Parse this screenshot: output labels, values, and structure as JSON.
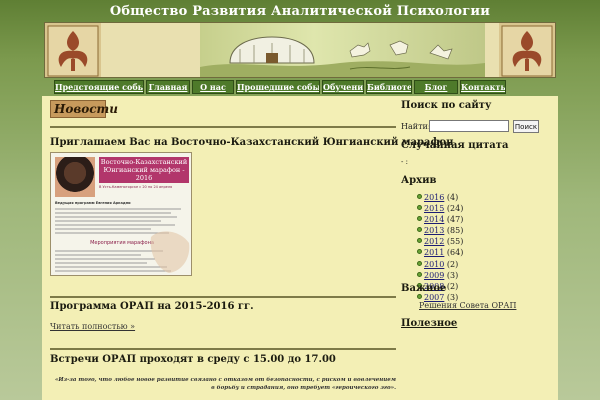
{
  "site": {
    "title": "Общество Развития Аналитической Психологии"
  },
  "nav": {
    "items": [
      {
        "label": "Предстоящие события"
      },
      {
        "label": "Главная"
      },
      {
        "label": "О нас"
      },
      {
        "label": "Прошедшие события"
      },
      {
        "label": "Обучение"
      },
      {
        "label": "Библиотека"
      },
      {
        "label": "Блог"
      },
      {
        "label": "Контакты"
      }
    ]
  },
  "main": {
    "section_title": "Новости",
    "posts": [
      {
        "title": "Приглашаем Вас на Восточно-Казахстанский Юнгианский марафон",
        "image": {
          "banner_title": "Восточно-Казахстанский Юнгианский марафон - 2016",
          "banner_subtitle": "В Усть-Каменогорске с 20 по 24 апреля",
          "host": "Ведущая программ Евгения Аркадни",
          "program_heading": "Мероприятия марафона"
        }
      },
      {
        "title": "Программа ОРАП на 2015-2016 гг.",
        "read_more": "Читать полностью »"
      },
      {
        "title": "Встречи ОРАП проходят в среду с 15.00 до 17.00",
        "quote": "«Из-за того, что любое новое развитие связано с отказом от безопасности, с риском и вовлечением в борьбу и страдания, оно требует «героического эго»."
      }
    ]
  },
  "sidebar": {
    "search_heading": "Поиск по сайту",
    "search_label": "Найти:",
    "search_value": "",
    "search_button": "Поиск",
    "quote_heading": "Случайная цитата",
    "quote_text": "- :",
    "archive_heading": "Архив",
    "archive": [
      {
        "year": "2016",
        "count": "(4)"
      },
      {
        "year": "2015",
        "count": "(24)"
      },
      {
        "year": "2014",
        "count": "(47)"
      },
      {
        "year": "2013",
        "count": "(85)"
      },
      {
        "year": "2012",
        "count": "(55)"
      },
      {
        "year": "2011",
        "count": "(64)"
      },
      {
        "year": "2010",
        "count": "(2)"
      },
      {
        "year": "2009",
        "count": "(3)"
      },
      {
        "year": "2008",
        "count": "(2)"
      },
      {
        "year": "2007",
        "count": "(3)"
      }
    ],
    "important_heading": "Важное",
    "important_link": "Решения Совета ОРАП",
    "useful_heading": "Полезное"
  },
  "colors": {
    "nav_bg": "#4e7a2a",
    "content_bg": "#f3efb5",
    "heading_box": "#c79a5c",
    "bullet": "#6aa336"
  }
}
